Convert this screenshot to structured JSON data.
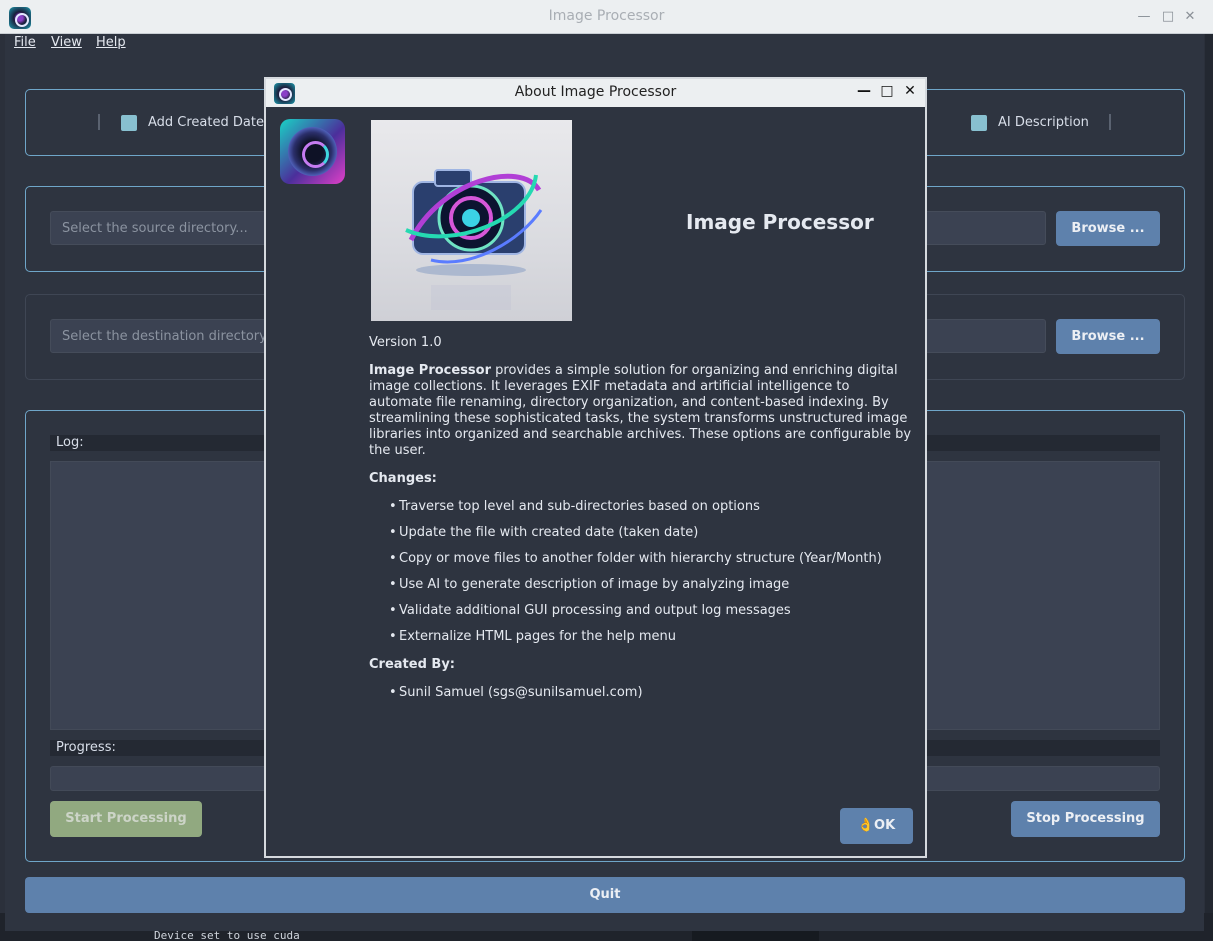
{
  "window": {
    "title": "Image Processor",
    "controls": {
      "minimize": "—",
      "maximize": "□",
      "close": "✕"
    }
  },
  "menu": {
    "file": "File",
    "view": "View",
    "help": "Help"
  },
  "options": {
    "add_created_date": "Add Created Date",
    "ai_description": "AI Description",
    "checkbox_color": "#88c0d0"
  },
  "source": {
    "placeholder": "Select the source directory...",
    "browse": "Browse ..."
  },
  "destination": {
    "placeholder": "Select the destination directory",
    "browse": "Browse ..."
  },
  "log": {
    "label": "Log:"
  },
  "progress": {
    "label": "Progress:"
  },
  "actions": {
    "start": "Start Processing",
    "stop": "Stop Processing",
    "quit": "Quit"
  },
  "colors": {
    "accent": "#5e81ac",
    "start_button": "#a3be8c",
    "panel_border": "#6fa6c9"
  },
  "dialog": {
    "title": "About Image Processor",
    "heading": "Image Processor",
    "version": "Version 1.0",
    "description_bold": "Image Processor",
    "description_rest": " provides a simple solution for organizing and enriching digital image collections. It leverages EXIF metadata and artificial intelligence to automate file renaming, directory organization, and content-based indexing. By streamlining these sophisticated tasks, the system transforms unstructured image libraries into organized and searchable archives. These options are configurable by the user.",
    "changes_title": "Changes:",
    "changes": [
      "Traverse top level and sub-directories based on options",
      "Update the file with created date (taken date)",
      "Copy or move files to another folder with hierarchy structure (Year/Month)",
      "Use AI to generate description of image by analyzing image",
      "Validate additional GUI processing and output log messages",
      "Externalize HTML pages for the help menu"
    ],
    "created_by_title": "Created By:",
    "authors": [
      "Sunil Samuel (sgs@sunilsamuel.com)"
    ],
    "ok": "OK",
    "ok_icon": "ok-hand-icon"
  },
  "background_terminal": {
    "text": "Device set to use cuda"
  }
}
